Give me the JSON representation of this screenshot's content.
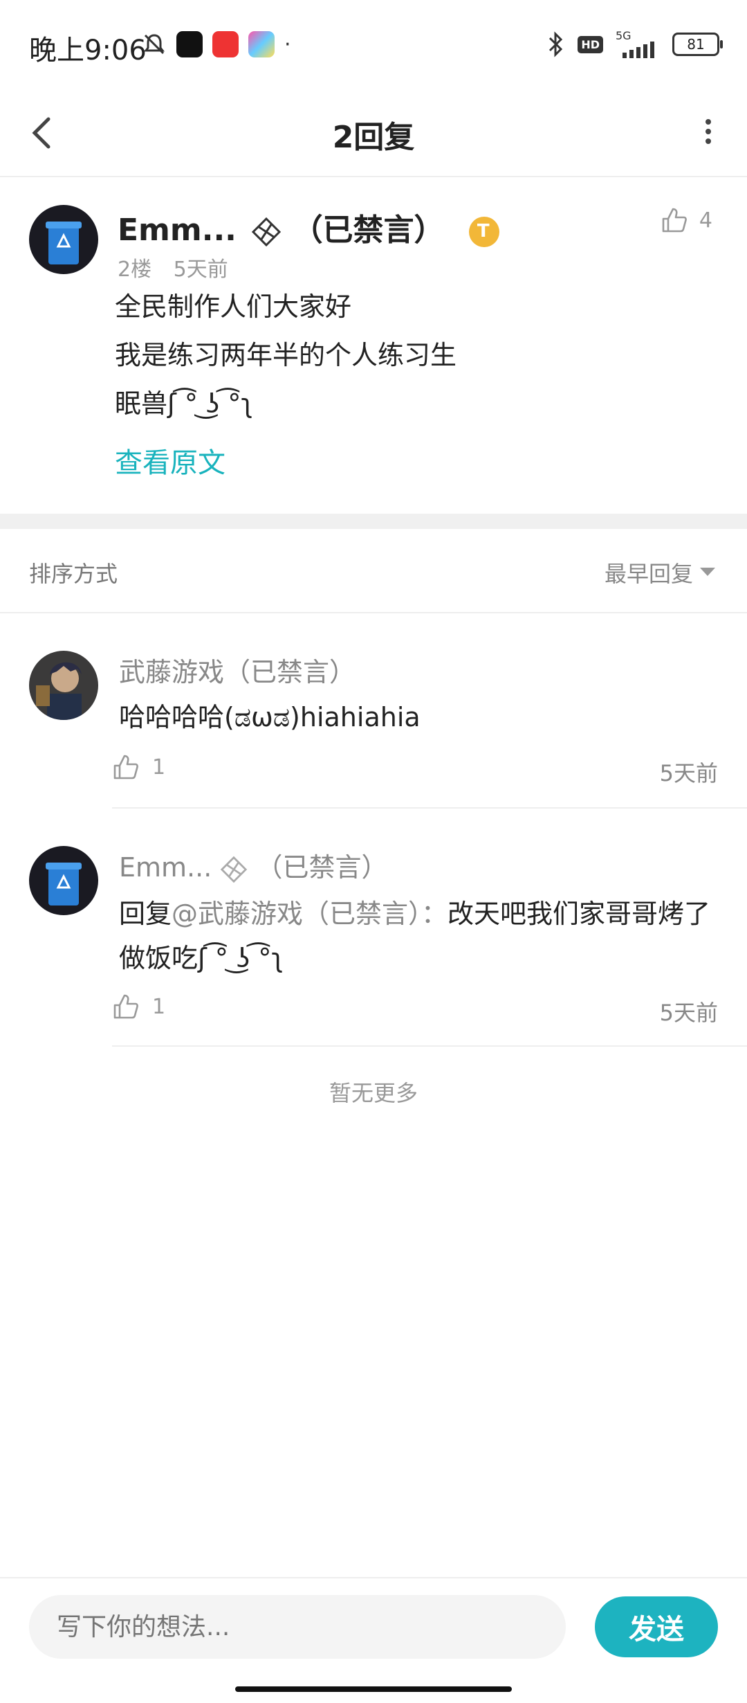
{
  "status_bar": {
    "time": "晚上9:06",
    "network": "5G",
    "hd": "HD",
    "battery": "81"
  },
  "header": {
    "title": "2回复"
  },
  "post": {
    "username": "Emm...",
    "muted_tag": "（已禁言）",
    "floor": "2楼",
    "time": "5天前",
    "likes": "4",
    "lines": [
      "全民制作人们大家好",
      "我是练习两年半的个人练习生",
      "眠兽ʃ ͡° ͜ʖ ͡°ʅ"
    ],
    "view_original": "查看原文"
  },
  "sort": {
    "label": "排序方式",
    "value": "最早回复"
  },
  "replies": [
    {
      "username": "武藤游戏（已禁言）",
      "text": "哈哈哈哈(ಡωಡ)hiahiahia",
      "likes": "1",
      "time": "5天前"
    },
    {
      "username": "Emm...",
      "muted_tag": "（已禁言）",
      "reply_prefix": "回复",
      "reply_to": "@武藤游戏（已禁言）：",
      "text": "改天吧我们家哥哥烤了做饭吃ʃ ͡° ͜ʖ ͡°ʅ",
      "likes": "1",
      "time": "5天前"
    }
  ],
  "no_more": "暂无更多",
  "composer": {
    "placeholder": "写下你的想法...",
    "send_label": "发送"
  },
  "colors": {
    "accent": "#1db3c0",
    "link": "#19b3bd",
    "badge": "#f2b738"
  }
}
